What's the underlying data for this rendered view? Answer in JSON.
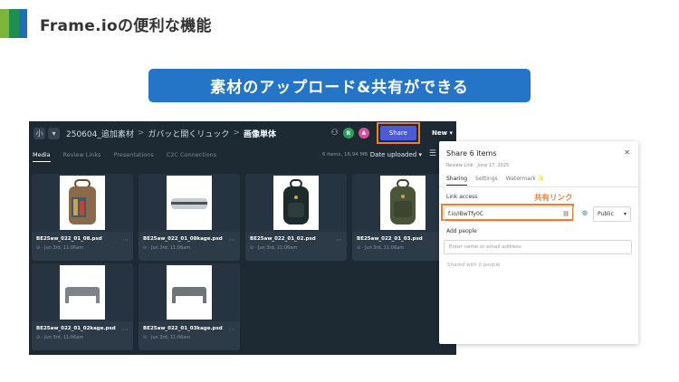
{
  "slide": {
    "title": "Frame.ioの便利な機能",
    "banner": "素材のアップロード&共有ができる",
    "callout": "共有リンク"
  },
  "app": {
    "breadcrumb": {
      "items": [
        "250604_追加素材",
        "ガバッと開くリュック",
        "画像単体"
      ],
      "separator": ">"
    },
    "top_icons": {
      "small_btn": "小"
    },
    "avatars": [
      {
        "initial": "R",
        "color": "#2f9e5b"
      },
      {
        "initial": "A",
        "color": "#d94f9b"
      }
    ],
    "share_label": "Share",
    "new_label": "New",
    "tabs": [
      "Media",
      "Review Links",
      "Presentations",
      "C2C Connections"
    ],
    "item_meta": "6 items, 16.94 MB",
    "sort_label": "Date uploaded",
    "files": [
      {
        "name": "BE25aw_022_01_08.psd",
        "meta": "Jun 3rd, 11:06am"
      },
      {
        "name": "BE25aw_022_01_08kage.psd",
        "meta": "Jun 3rd, 11:06am"
      },
      {
        "name": "BE25aw_022_01_02.psd",
        "meta": "Jun 3rd, 11:06am"
      },
      {
        "name": "BE25aw_022_01_03.psd",
        "meta": "Jun 3rd, 11:06am"
      },
      {
        "name": "BE25aw_022_01_02kage.psd",
        "meta": "Jun 3rd, 11:06am"
      },
      {
        "name": "BE25aw_022_01_03kage.psd",
        "meta": "Jun 3rd, 11:06am"
      }
    ]
  },
  "share_panel": {
    "title": "Share 6 items",
    "subtitle": "Review Link · June 17, 2025",
    "tabs": [
      "Sharing",
      "Settings",
      "Watermark ✨"
    ],
    "link_access_label": "Link access",
    "link_value": "f.io/IBwTfy0C",
    "visibility": "Public",
    "add_people_label": "Add people",
    "email_placeholder": "Enter name or email address",
    "shared_with": "Shared with 0 people"
  },
  "colors": {
    "banner": "#2474c8",
    "highlight": "#e7812b",
    "share_button": "#4c59d8",
    "app_bg": "#1d2a33"
  }
}
